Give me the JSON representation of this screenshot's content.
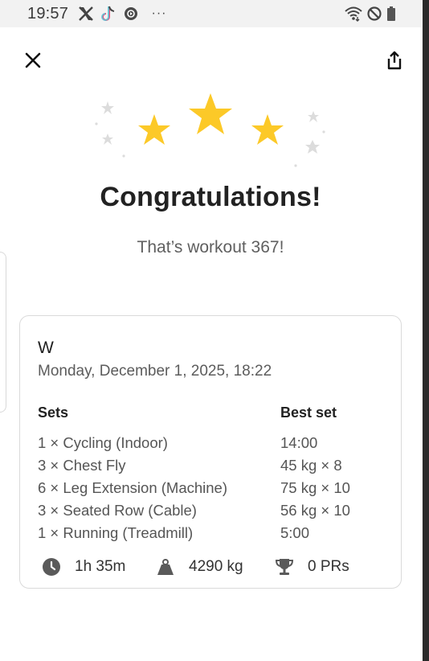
{
  "status_bar": {
    "time": "19:57",
    "left_icons": [
      "x-app-icon",
      "tiktok-icon",
      "media-circle-icon",
      "more-dots-icon"
    ],
    "right_icons": [
      "wifi-icon",
      "do-not-disturb-icon",
      "battery-icon"
    ],
    "more_dots": "···"
  },
  "top_bar": {
    "close_icon": "close-icon",
    "share_icon": "share-icon"
  },
  "celebration": {
    "headline": "Congratulations!",
    "subline": "That’s workout 367!",
    "star_color": "#FCC928",
    "sparkle_color": "#DCDCDC"
  },
  "summary_card": {
    "title": "W",
    "date": "Monday, December 1, 2025, 18:22",
    "sets_header": "Sets",
    "best_set_header": "Best set",
    "exercises": [
      {
        "sets": "1 × Cycling (Indoor)",
        "best": "14:00"
      },
      {
        "sets": "3 × Chest Fly",
        "best": "45 kg × 8"
      },
      {
        "sets": "6 × Leg Extension (Machine)",
        "best": "75 kg × 10"
      },
      {
        "sets": "3 × Seated Row (Cable)",
        "best": "56 kg × 10"
      },
      {
        "sets": "1 × Running (Treadmill)",
        "best": "5:00"
      }
    ],
    "stats": {
      "duration": "1h 35m",
      "volume": "4290 kg",
      "prs": "0 PRs"
    }
  }
}
